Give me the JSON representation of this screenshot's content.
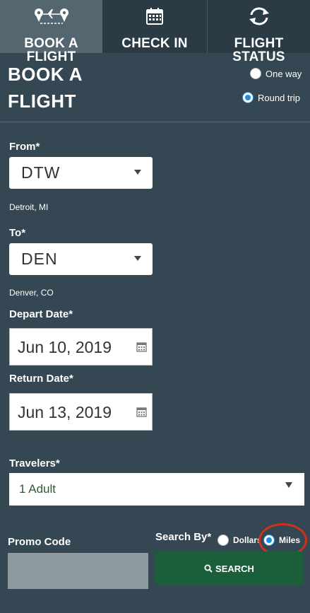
{
  "tabs": [
    {
      "label_line1": "BOOK A",
      "label_line2": "FLIGHT",
      "icon": "plane-route-icon"
    },
    {
      "label": "CHECK IN",
      "icon": "calendar-icon"
    },
    {
      "label_line1": "FLIGHT",
      "label_line2": "STATUS",
      "icon": "refresh-icon"
    }
  ],
  "heading": {
    "line1": "BOOK A",
    "line2": "FLIGHT"
  },
  "trip_type": {
    "options": [
      {
        "label": "One way",
        "selected": false
      },
      {
        "label": "Round trip",
        "selected": true
      }
    ]
  },
  "from": {
    "label": "From*",
    "value": "DTW",
    "city": "Detroit, MI"
  },
  "to": {
    "label": "To*",
    "value": "DEN",
    "city": "Denver, CO"
  },
  "depart": {
    "label": "Depart Date*",
    "value": "Jun 10, 2019"
  },
  "return": {
    "label": "Return Date*",
    "value": "Jun 13, 2019"
  },
  "travelers": {
    "label": "Travelers*",
    "value": "1 Adult"
  },
  "promo": {
    "label": "Promo Code",
    "value": ""
  },
  "search_by": {
    "label": "Search By*",
    "options": [
      {
        "label": "Dollars",
        "selected": false
      },
      {
        "label": "Miles",
        "selected": true
      }
    ]
  },
  "search_button": {
    "label": "SEARCH"
  },
  "colors": {
    "background": "#354752",
    "search_button": "#1a5e3a",
    "highlight_circle": "#d0311f",
    "radio_selected": "#1d8fe0"
  }
}
